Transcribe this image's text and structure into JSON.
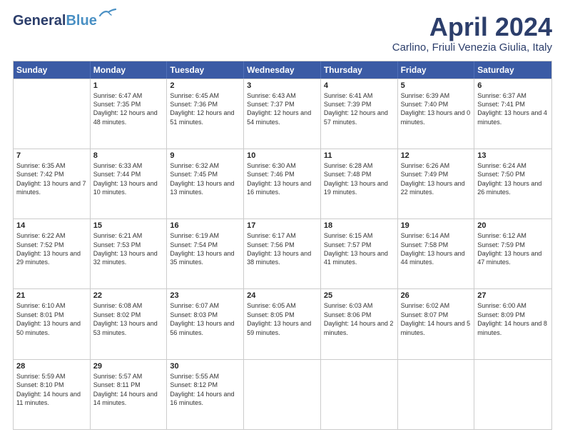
{
  "logo": {
    "line1": "General",
    "line2": "Blue"
  },
  "title": "April 2024",
  "subtitle": "Carlino, Friuli Venezia Giulia, Italy",
  "days": [
    "Sunday",
    "Monday",
    "Tuesday",
    "Wednesday",
    "Thursday",
    "Friday",
    "Saturday"
  ],
  "weeks": [
    [
      {
        "day": "",
        "sunrise": "",
        "sunset": "",
        "daylight": ""
      },
      {
        "day": "1",
        "sunrise": "Sunrise: 6:47 AM",
        "sunset": "Sunset: 7:35 PM",
        "daylight": "Daylight: 12 hours and 48 minutes."
      },
      {
        "day": "2",
        "sunrise": "Sunrise: 6:45 AM",
        "sunset": "Sunset: 7:36 PM",
        "daylight": "Daylight: 12 hours and 51 minutes."
      },
      {
        "day": "3",
        "sunrise": "Sunrise: 6:43 AM",
        "sunset": "Sunset: 7:37 PM",
        "daylight": "Daylight: 12 hours and 54 minutes."
      },
      {
        "day": "4",
        "sunrise": "Sunrise: 6:41 AM",
        "sunset": "Sunset: 7:39 PM",
        "daylight": "Daylight: 12 hours and 57 minutes."
      },
      {
        "day": "5",
        "sunrise": "Sunrise: 6:39 AM",
        "sunset": "Sunset: 7:40 PM",
        "daylight": "Daylight: 13 hours and 0 minutes."
      },
      {
        "day": "6",
        "sunrise": "Sunrise: 6:37 AM",
        "sunset": "Sunset: 7:41 PM",
        "daylight": "Daylight: 13 hours and 4 minutes."
      }
    ],
    [
      {
        "day": "7",
        "sunrise": "Sunrise: 6:35 AM",
        "sunset": "Sunset: 7:42 PM",
        "daylight": "Daylight: 13 hours and 7 minutes."
      },
      {
        "day": "8",
        "sunrise": "Sunrise: 6:33 AM",
        "sunset": "Sunset: 7:44 PM",
        "daylight": "Daylight: 13 hours and 10 minutes."
      },
      {
        "day": "9",
        "sunrise": "Sunrise: 6:32 AM",
        "sunset": "Sunset: 7:45 PM",
        "daylight": "Daylight: 13 hours and 13 minutes."
      },
      {
        "day": "10",
        "sunrise": "Sunrise: 6:30 AM",
        "sunset": "Sunset: 7:46 PM",
        "daylight": "Daylight: 13 hours and 16 minutes."
      },
      {
        "day": "11",
        "sunrise": "Sunrise: 6:28 AM",
        "sunset": "Sunset: 7:48 PM",
        "daylight": "Daylight: 13 hours and 19 minutes."
      },
      {
        "day": "12",
        "sunrise": "Sunrise: 6:26 AM",
        "sunset": "Sunset: 7:49 PM",
        "daylight": "Daylight: 13 hours and 22 minutes."
      },
      {
        "day": "13",
        "sunrise": "Sunrise: 6:24 AM",
        "sunset": "Sunset: 7:50 PM",
        "daylight": "Daylight: 13 hours and 26 minutes."
      }
    ],
    [
      {
        "day": "14",
        "sunrise": "Sunrise: 6:22 AM",
        "sunset": "Sunset: 7:52 PM",
        "daylight": "Daylight: 13 hours and 29 minutes."
      },
      {
        "day": "15",
        "sunrise": "Sunrise: 6:21 AM",
        "sunset": "Sunset: 7:53 PM",
        "daylight": "Daylight: 13 hours and 32 minutes."
      },
      {
        "day": "16",
        "sunrise": "Sunrise: 6:19 AM",
        "sunset": "Sunset: 7:54 PM",
        "daylight": "Daylight: 13 hours and 35 minutes."
      },
      {
        "day": "17",
        "sunrise": "Sunrise: 6:17 AM",
        "sunset": "Sunset: 7:56 PM",
        "daylight": "Daylight: 13 hours and 38 minutes."
      },
      {
        "day": "18",
        "sunrise": "Sunrise: 6:15 AM",
        "sunset": "Sunset: 7:57 PM",
        "daylight": "Daylight: 13 hours and 41 minutes."
      },
      {
        "day": "19",
        "sunrise": "Sunrise: 6:14 AM",
        "sunset": "Sunset: 7:58 PM",
        "daylight": "Daylight: 13 hours and 44 minutes."
      },
      {
        "day": "20",
        "sunrise": "Sunrise: 6:12 AM",
        "sunset": "Sunset: 7:59 PM",
        "daylight": "Daylight: 13 hours and 47 minutes."
      }
    ],
    [
      {
        "day": "21",
        "sunrise": "Sunrise: 6:10 AM",
        "sunset": "Sunset: 8:01 PM",
        "daylight": "Daylight: 13 hours and 50 minutes."
      },
      {
        "day": "22",
        "sunrise": "Sunrise: 6:08 AM",
        "sunset": "Sunset: 8:02 PM",
        "daylight": "Daylight: 13 hours and 53 minutes."
      },
      {
        "day": "23",
        "sunrise": "Sunrise: 6:07 AM",
        "sunset": "Sunset: 8:03 PM",
        "daylight": "Daylight: 13 hours and 56 minutes."
      },
      {
        "day": "24",
        "sunrise": "Sunrise: 6:05 AM",
        "sunset": "Sunset: 8:05 PM",
        "daylight": "Daylight: 13 hours and 59 minutes."
      },
      {
        "day": "25",
        "sunrise": "Sunrise: 6:03 AM",
        "sunset": "Sunset: 8:06 PM",
        "daylight": "Daylight: 14 hours and 2 minutes."
      },
      {
        "day": "26",
        "sunrise": "Sunrise: 6:02 AM",
        "sunset": "Sunset: 8:07 PM",
        "daylight": "Daylight: 14 hours and 5 minutes."
      },
      {
        "day": "27",
        "sunrise": "Sunrise: 6:00 AM",
        "sunset": "Sunset: 8:09 PM",
        "daylight": "Daylight: 14 hours and 8 minutes."
      }
    ],
    [
      {
        "day": "28",
        "sunrise": "Sunrise: 5:59 AM",
        "sunset": "Sunset: 8:10 PM",
        "daylight": "Daylight: 14 hours and 11 minutes."
      },
      {
        "day": "29",
        "sunrise": "Sunrise: 5:57 AM",
        "sunset": "Sunset: 8:11 PM",
        "daylight": "Daylight: 14 hours and 14 minutes."
      },
      {
        "day": "30",
        "sunrise": "Sunrise: 5:55 AM",
        "sunset": "Sunset: 8:12 PM",
        "daylight": "Daylight: 14 hours and 16 minutes."
      },
      {
        "day": "",
        "sunrise": "",
        "sunset": "",
        "daylight": ""
      },
      {
        "day": "",
        "sunrise": "",
        "sunset": "",
        "daylight": ""
      },
      {
        "day": "",
        "sunrise": "",
        "sunset": "",
        "daylight": ""
      },
      {
        "day": "",
        "sunrise": "",
        "sunset": "",
        "daylight": ""
      }
    ]
  ]
}
